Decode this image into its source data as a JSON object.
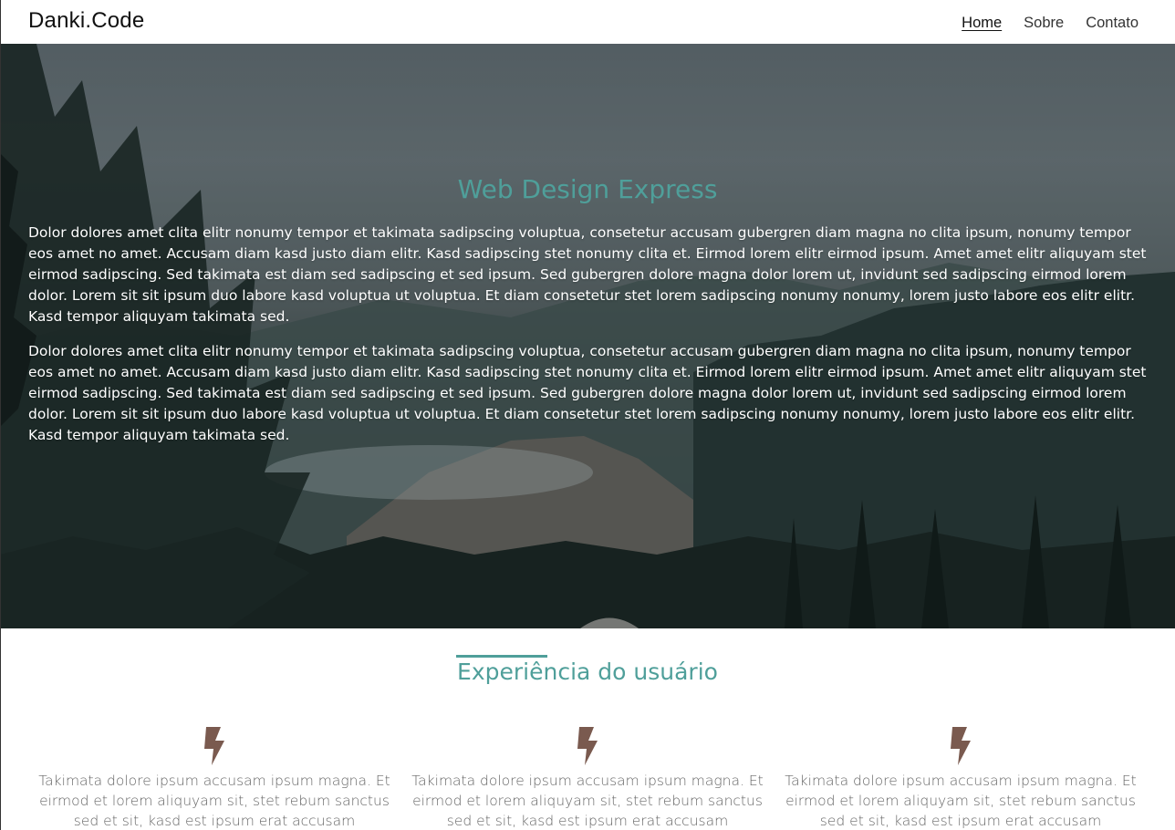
{
  "header": {
    "logo": "Danki.Code",
    "nav": [
      {
        "label": "Home",
        "active": true
      },
      {
        "label": "Sobre",
        "active": false
      },
      {
        "label": "Contato",
        "active": false
      }
    ]
  },
  "hero": {
    "title": "Web Design Express",
    "paragraphs": [
      "Dolor dolores amet clita elitr nonumy tempor et takimata sadipscing voluptua, consetetur accusam gubergren diam magna no clita ipsum, nonumy tempor eos amet no amet. Accusam diam kasd justo diam elitr. Kasd sadipscing stet nonumy clita et. Eirmod lorem elitr eirmod ipsum. Amet amet elitr aliquyam stet eirmod sadipscing. Sed takimata est diam sed sadipscing et sed ipsum. Sed gubergren dolore magna dolor lorem ut, invidunt sed sadipscing eirmod lorem dolor. Lorem sit sit ipsum duo labore kasd voluptua ut voluptua. Et diam consetetur stet lorem sadipscing nonumy nonumy, lorem justo labore eos elitr elitr. Kasd tempor aliquyam takimata sed.",
      "Dolor dolores amet clita elitr nonumy tempor et takimata sadipscing voluptua, consetetur accusam gubergren diam magna no clita ipsum, nonumy tempor eos amet no amet. Accusam diam kasd justo diam elitr. Kasd sadipscing stet nonumy clita et. Eirmod lorem elitr eirmod ipsum. Amet amet elitr aliquyam stet eirmod sadipscing. Sed takimata est diam sed sadipscing et sed ipsum. Sed gubergren dolore magna dolor lorem ut, invidunt sed sadipscing eirmod lorem dolor. Lorem sit sit ipsum duo labore kasd voluptua ut voluptua. Et diam consetetur stet lorem sadipscing nonumy nonumy, lorem justo labore eos elitr elitr. Kasd tempor aliquyam takimata sed."
    ]
  },
  "experience": {
    "title": "Experiência do usuário",
    "features": [
      {
        "icon": "lightning-bolt-icon",
        "text": "Takimata dolore ipsum accusam ipsum magna. Et eirmod et lorem aliquyam sit, stet rebum sanctus sed et sit, kasd est ipsum erat accusam consetetur justo"
      },
      {
        "icon": "lightning-bolt-icon",
        "text": "Takimata dolore ipsum accusam ipsum magna. Et eirmod et lorem aliquyam sit, stet rebum sanctus sed et sit, kasd est ipsum erat accusam consetetur justo"
      },
      {
        "icon": "lightning-bolt-icon",
        "text": "Takimata dolore ipsum accusam ipsum magna. Et eirmod et lorem aliquyam sit, stet rebum sanctus sed et sit, kasd est ipsum erat accusam consetetur justo"
      }
    ]
  },
  "colors": {
    "accent": "#4f9f9a",
    "icon": "#7a5a4f",
    "text_muted": "#666666"
  }
}
